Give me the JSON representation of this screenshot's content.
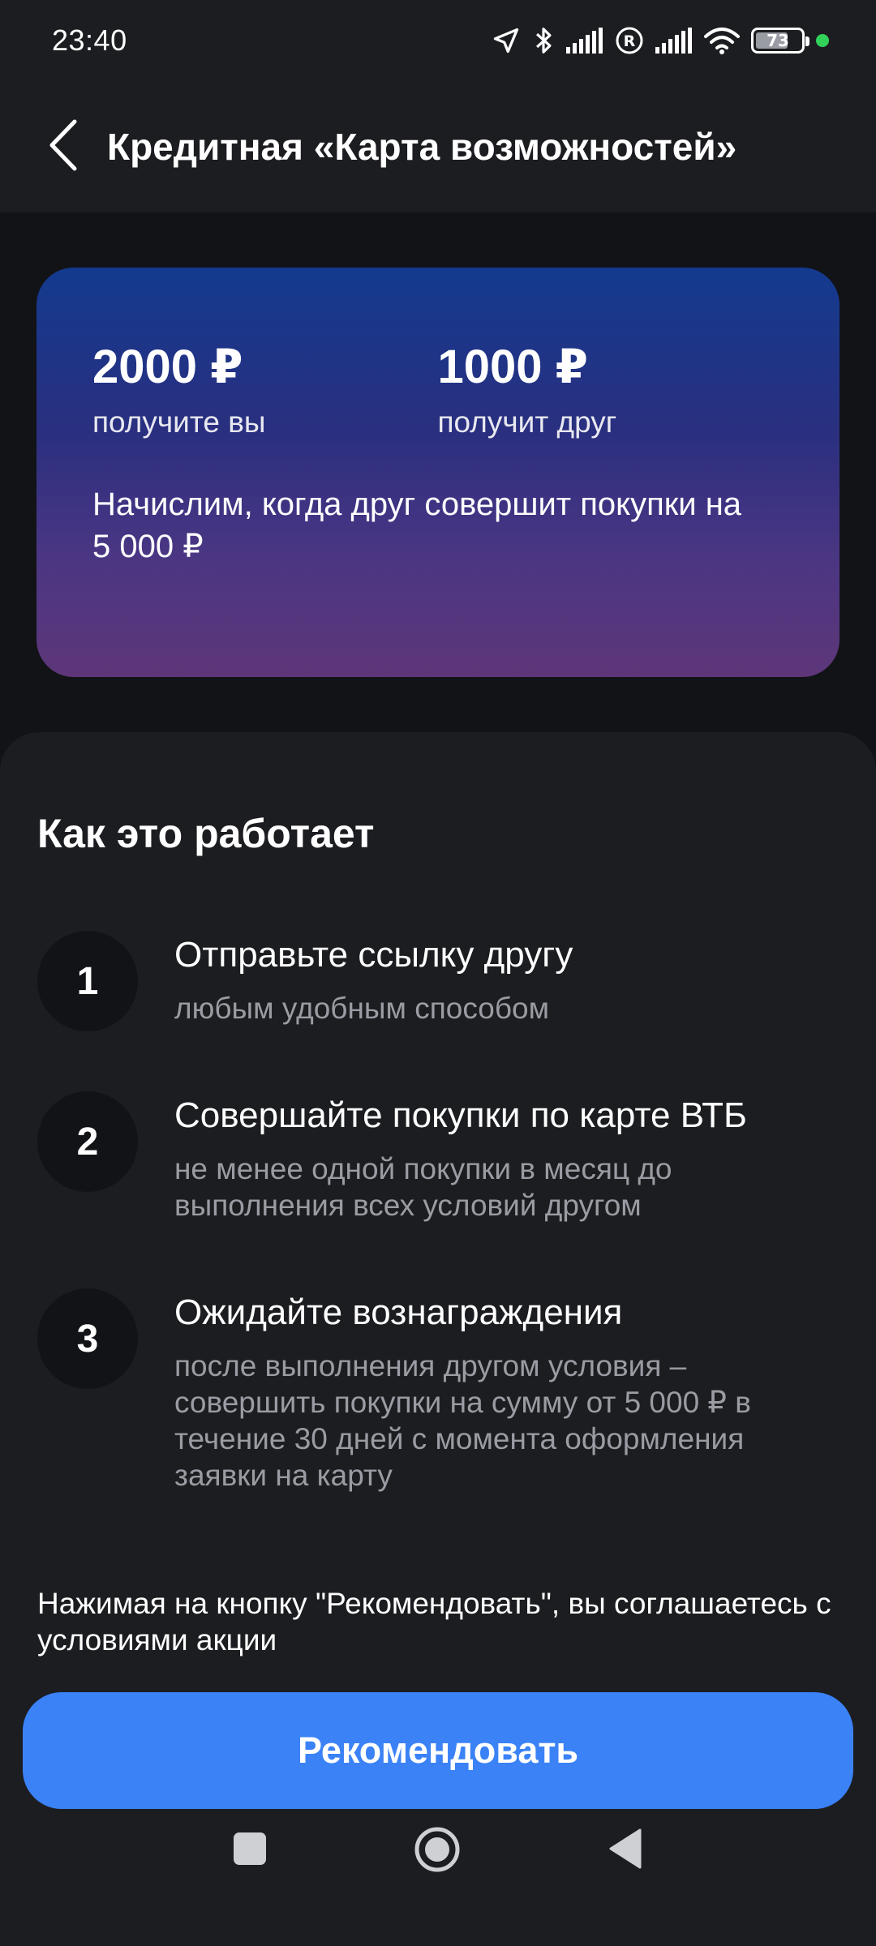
{
  "status_bar": {
    "time": "23:40",
    "battery_level": 73,
    "battery_text": "73",
    "icons": [
      "location-icon",
      "bluetooth-icon",
      "signal-icon",
      "roaming-icon",
      "signal-icon",
      "wifi-icon",
      "battery-icon"
    ]
  },
  "header": {
    "title": "Кредитная «Карта возможностей»"
  },
  "promo": {
    "you_amount": "2000 ₽",
    "you_caption": "получите вы",
    "friend_amount": "1000 ₽",
    "friend_caption": "получит друг",
    "note": "Начислим, когда друг совершит покупки на 5 000 ₽"
  },
  "how_it_works": {
    "title": "Как это работает",
    "steps": [
      {
        "number": "1",
        "title": "Отправьте ссылку другу",
        "desc": "любым удобным способом"
      },
      {
        "number": "2",
        "title": "Совершайте покупки по карте ВТБ",
        "desc": "не менее одной покупки в месяц до выполнения всех условий другом"
      },
      {
        "number": "3",
        "title": "Ожидайте вознаграждения",
        "desc": "после выполнения другом условия – совершить покупки на сумму от 5 000 ₽ в течение 30 дней с момента оформления заявки на карту"
      }
    ]
  },
  "terms_text": "Нажимая на кнопку \"Рекомендовать\", вы соглашаетесь с условиями акции",
  "recommend_button": "Рекомендовать",
  "colors": {
    "background": "#121317",
    "surface": "#1c1d21",
    "accent": "#3b82f6",
    "muted_text": "#9a9ca3",
    "card_gradient_top": "#133a8f",
    "card_gradient_bottom": "#5e3679"
  }
}
